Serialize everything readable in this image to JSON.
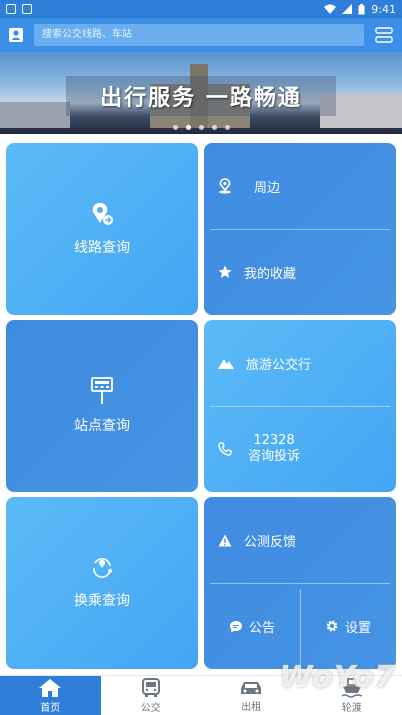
{
  "status_bar": {
    "time": "9:41"
  },
  "header": {
    "search_placeholder": "搜索公交线路、车站"
  },
  "banner": {
    "slogan": "出行服务 一路畅通",
    "slides": 5,
    "active_slide": 1
  },
  "tiles": {
    "route_query": "线路查询",
    "nearby": "周边",
    "favorites": "我的收藏",
    "station_query": "站点查询",
    "tour_bus": "旅游公交行",
    "hotline_number": "12328",
    "hotline_label": "咨询投诉",
    "transfer_query": "换乘查询",
    "feedback": "公测反馈",
    "notice": "公告",
    "settings": "设置"
  },
  "bottom_nav": [
    {
      "label": "首页",
      "icon": "home-icon",
      "active": true
    },
    {
      "label": "公交",
      "icon": "bus-icon",
      "active": false
    },
    {
      "label": "出租",
      "icon": "taxi-icon",
      "active": false
    },
    {
      "label": "轮渡",
      "icon": "ferry-icon",
      "active": false
    }
  ],
  "watermark": "WoYo7",
  "colors": {
    "primary": "#3b8fe6",
    "tile_light": "#4fb0f5",
    "tile_dark": "#4290e3"
  }
}
